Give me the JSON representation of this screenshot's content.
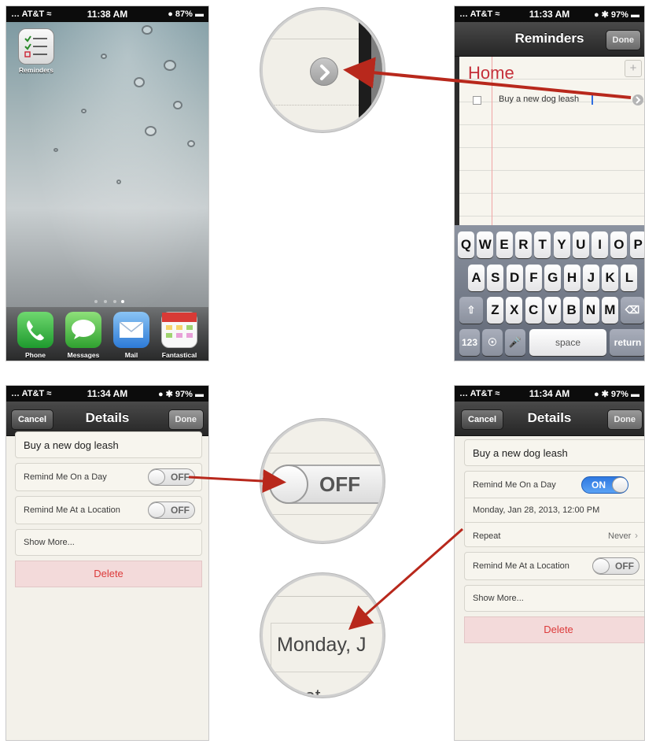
{
  "home": {
    "status": {
      "carrier": "… AT&T ≈",
      "time": "11:38 AM",
      "battery": "● 87% ▬"
    },
    "reminders_label": "Reminders",
    "dock": [
      "Phone",
      "Messages",
      "Mail",
      "Fantastical"
    ]
  },
  "reminders": {
    "status": {
      "carrier": "… AT&T ≈",
      "time": "11:33 AM",
      "battery": "● ✱ 97% ▬"
    },
    "nav_title": "Reminders",
    "done": "Done",
    "list_title": "Home",
    "item": "Buy a new dog leash",
    "keys_row1": [
      "Q",
      "W",
      "E",
      "R",
      "T",
      "Y",
      "U",
      "I",
      "O",
      "P"
    ],
    "keys_row2": [
      "A",
      "S",
      "D",
      "F",
      "G",
      "H",
      "J",
      "K",
      "L"
    ],
    "keys_row3": [
      "Z",
      "X",
      "C",
      "V",
      "B",
      "N",
      "M"
    ],
    "key_123": "123",
    "key_space": "space",
    "key_return": "return"
  },
  "details_off": {
    "status": {
      "carrier": "… AT&T ≈",
      "time": "11:34 AM",
      "battery": "● ✱ 97% ▬"
    },
    "cancel": "Cancel",
    "nav_title": "Details",
    "done": "Done",
    "title": "Buy a new dog leash",
    "remind_day": "Remind Me On a Day",
    "remind_location": "Remind Me At a Location",
    "toggle_off": "OFF",
    "show_more": "Show More...",
    "delete": "Delete"
  },
  "details_on": {
    "status": {
      "carrier": "… AT&T ≈",
      "time": "11:34 AM",
      "battery": "● ✱ 97% ▬"
    },
    "cancel": "Cancel",
    "nav_title": "Details",
    "done": "Done",
    "title": "Buy a new dog leash",
    "remind_day": "Remind Me On a Day",
    "toggle_on": "ON",
    "date": "Monday, Jan 28, 2013, 12:00 PM",
    "repeat": "Repeat",
    "repeat_value": "Never",
    "remind_location": "Remind Me At a Location",
    "toggle_off": "OFF",
    "show_more": "Show More...",
    "delete": "Delete"
  },
  "zoom": {
    "toggle_off": "OFF",
    "date_crop": "Monday, J",
    "repeat_crop": "Repeat"
  },
  "colors": {
    "accent_red": "#b8281c",
    "toggle_blue": "#2f79e0",
    "list_title_red": "#c5303a"
  }
}
